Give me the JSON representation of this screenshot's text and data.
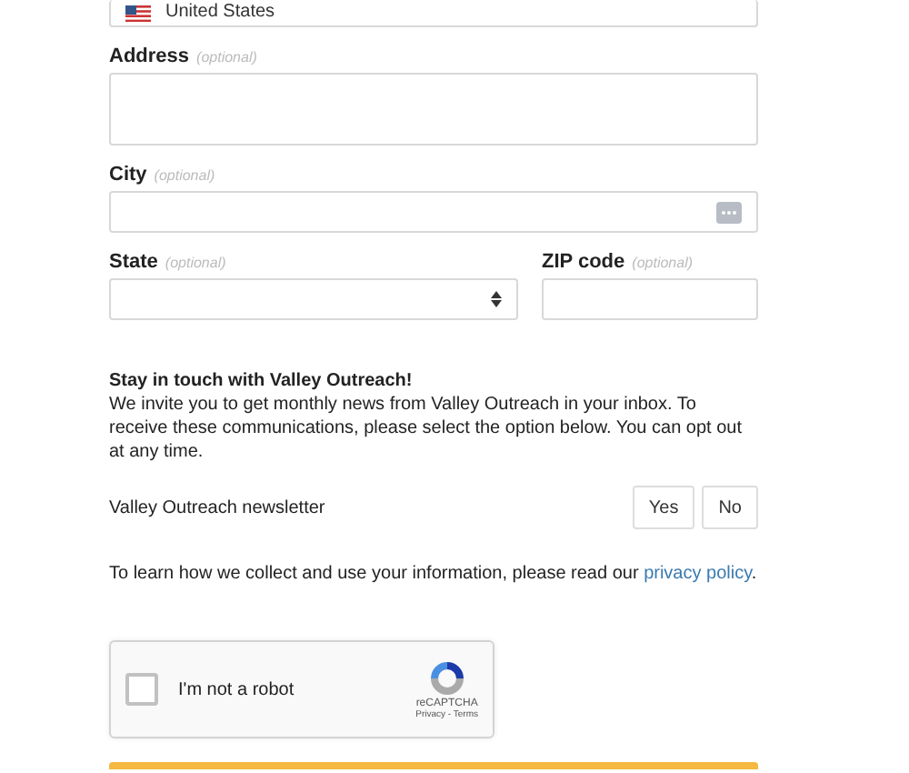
{
  "country_field": {
    "value": "United States"
  },
  "fields": [
    {
      "kind": "textarea",
      "label": "Address",
      "hint": "(optional)"
    },
    {
      "kind": "text",
      "label": "City",
      "hint": "(optional)"
    }
  ],
  "row_fields": [
    {
      "kind": "select",
      "label": "State",
      "hint": "(optional)"
    },
    {
      "kind": "text",
      "label": "ZIP code",
      "hint": "(optional)"
    }
  ],
  "newsletter": {
    "heading": "Stay in touch with Valley Outreach!",
    "text": "We invite you to get monthly news from Valley Outreach in your inbox. To receive these communications, please select the option below. You can opt out at any time.",
    "label": "Valley Outreach newsletter",
    "options": [
      {
        "label": "Yes",
        "selected": false
      },
      {
        "label": "No",
        "selected": false
      }
    ]
  },
  "privacy": {
    "text": "To learn how we collect and use your information, please read our ",
    "link": "privacy policy",
    "end": "."
  },
  "captcha": {
    "label": "I'm not a robot",
    "checked": false,
    "brand": "reCAPTCHA",
    "links": "Privacy - Terms"
  }
}
